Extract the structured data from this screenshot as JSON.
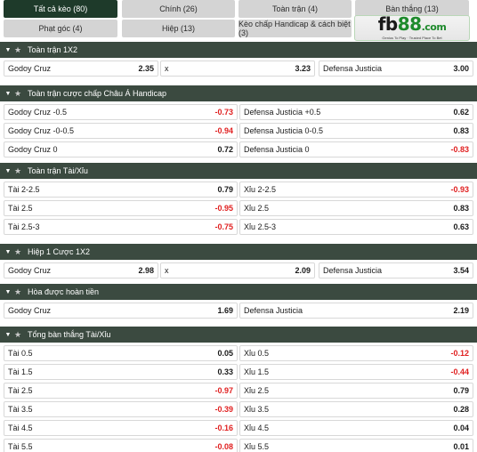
{
  "tabs": [
    {
      "label": "Tất cả kèo (80)",
      "active": true
    },
    {
      "label": "Chính (26)"
    },
    {
      "label": "Toàn trận (4)"
    },
    {
      "label": "Bàn thắng (13)"
    },
    {
      "label": "Phạt góc (4)"
    },
    {
      "label": "Hiệp (13)"
    },
    {
      "label": "Kèo chấp Handicap & cách biệt (3)"
    }
  ],
  "logo": {
    "fb": "fb",
    "n88": "88",
    "com": ".com",
    "tagline": "Genius To Play · Trusted Place To Bet"
  },
  "sections": [
    {
      "title": "Toàn trận 1X2",
      "rows": [
        [
          {
            "label": "Godoy Cruz",
            "odd": "2.35"
          },
          {
            "label": "x",
            "odd": "3.23"
          },
          {
            "label": "Defensa Justicia",
            "odd": "3.00"
          }
        ]
      ]
    },
    {
      "title": "Toàn trận cược chấp Châu Á Handicap",
      "rows": [
        [
          {
            "label": "Godoy Cruz -0.5",
            "odd": "-0.73"
          },
          {
            "label": "Defensa Justicia +0.5",
            "odd": "0.62"
          }
        ],
        [
          {
            "label": "Godoy Cruz -0-0.5",
            "odd": "-0.94"
          },
          {
            "label": "Defensa Justicia 0-0.5",
            "odd": "0.83"
          }
        ],
        [
          {
            "label": "Godoy Cruz 0",
            "odd": "0.72"
          },
          {
            "label": "Defensa Justicia 0",
            "odd": "-0.83"
          }
        ]
      ]
    },
    {
      "title": "Toàn trận Tài/Xỉu",
      "rows": [
        [
          {
            "label": "Tài 2-2.5",
            "odd": "0.79"
          },
          {
            "label": "Xỉu 2-2.5",
            "odd": "-0.93"
          }
        ],
        [
          {
            "label": "Tài 2.5",
            "odd": "-0.95"
          },
          {
            "label": "Xỉu 2.5",
            "odd": "0.83"
          }
        ],
        [
          {
            "label": "Tài 2.5-3",
            "odd": "-0.75"
          },
          {
            "label": "Xỉu 2.5-3",
            "odd": "0.63"
          }
        ]
      ]
    },
    {
      "title": "Hiệp 1 Cược 1X2",
      "rows": [
        [
          {
            "label": "Godoy Cruz",
            "odd": "2.98"
          },
          {
            "label": "x",
            "odd": "2.09"
          },
          {
            "label": "Defensa Justicia",
            "odd": "3.54"
          }
        ]
      ]
    },
    {
      "title": "Hòa được hoàn tiền",
      "rows": [
        [
          {
            "label": "Godoy Cruz",
            "odd": "1.69"
          },
          {
            "label": "Defensa Justicia",
            "odd": "2.19"
          }
        ]
      ]
    },
    {
      "title": "Tổng bàn thắng Tài/Xỉu",
      "rows": [
        [
          {
            "label": "Tài 0.5",
            "odd": "0.05"
          },
          {
            "label": "Xỉu 0.5",
            "odd": "-0.12"
          }
        ],
        [
          {
            "label": "Tài 1.5",
            "odd": "0.33"
          },
          {
            "label": "Xỉu 1.5",
            "odd": "-0.44"
          }
        ],
        [
          {
            "label": "Tài 2.5",
            "odd": "-0.97"
          },
          {
            "label": "Xỉu 2.5",
            "odd": "0.79"
          }
        ],
        [
          {
            "label": "Tài 3.5",
            "odd": "-0.39"
          },
          {
            "label": "Xỉu 3.5",
            "odd": "0.28"
          }
        ],
        [
          {
            "label": "Tài 4.5",
            "odd": "-0.16"
          },
          {
            "label": "Xỉu 4.5",
            "odd": "0.04"
          }
        ],
        [
          {
            "label": "Tài 5.5",
            "odd": "-0.08"
          },
          {
            "label": "Xỉu 5.5",
            "odd": "0.01"
          }
        ]
      ]
    }
  ],
  "icons": {
    "collapse": "chevron-down-icon",
    "favorite": "star-icon"
  },
  "colors": {
    "header_bg": "#3b4a40",
    "active_tab": "#1e3a2a",
    "negative_odd": "#e02020"
  }
}
